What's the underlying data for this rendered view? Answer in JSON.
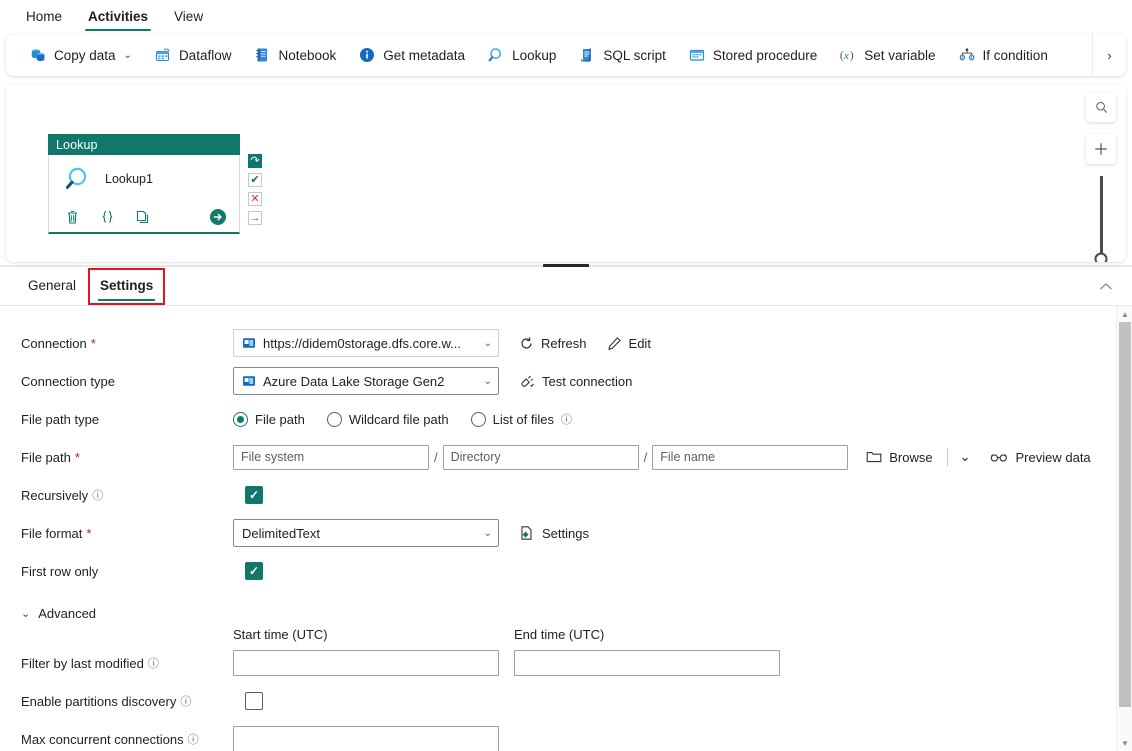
{
  "ribbon": {
    "tabs": [
      {
        "label": "Home",
        "active": false
      },
      {
        "label": "Activities",
        "active": true
      },
      {
        "label": "View",
        "active": false
      }
    ]
  },
  "command_bar": {
    "items": [
      {
        "label": "Copy data",
        "icon": "copy-data-icon",
        "has_chevron": true
      },
      {
        "label": "Dataflow",
        "icon": "dataflow-icon",
        "has_chevron": false
      },
      {
        "label": "Notebook",
        "icon": "notebook-icon",
        "has_chevron": false
      },
      {
        "label": "Get metadata",
        "icon": "info-circle-icon",
        "has_chevron": false
      },
      {
        "label": "Lookup",
        "icon": "magnifier-icon",
        "has_chevron": false
      },
      {
        "label": "SQL script",
        "icon": "sql-script-icon",
        "has_chevron": false
      },
      {
        "label": "Stored procedure",
        "icon": "stored-procedure-icon",
        "has_chevron": false
      },
      {
        "label": "Set variable",
        "icon": "set-variable-icon",
        "has_chevron": false
      },
      {
        "label": "If condition",
        "icon": "if-condition-icon",
        "has_chevron": false
      }
    ],
    "overflow_label": "›"
  },
  "canvas": {
    "node": {
      "header": "Lookup",
      "title": "Lookup1",
      "icon": "magnifier-icon",
      "actions": [
        {
          "name": "delete-activity-button",
          "glyph": "delete-icon"
        },
        {
          "name": "code-view-button",
          "glyph": "braces-icon"
        },
        {
          "name": "clone-activity-button",
          "glyph": "copy-icon"
        },
        {
          "name": "run-activity-button",
          "glyph": "arrow-right-circle-icon"
        }
      ],
      "badges": [
        {
          "name": "on-skip-badge",
          "glyph": "↷",
          "style": "teal"
        },
        {
          "name": "on-success-badge",
          "glyph": "✔",
          "style": "green"
        },
        {
          "name": "on-failure-badge",
          "glyph": "✕",
          "style": "red"
        },
        {
          "name": "on-completion-badge",
          "glyph": "→",
          "style": "blue"
        }
      ]
    },
    "zoom_controls": {
      "fit_label": "zoom-to-fit",
      "add_label": "+",
      "slider_value": 72
    }
  },
  "properties": {
    "tabs": [
      {
        "label": "General",
        "active": false,
        "annotated": false
      },
      {
        "label": "Settings",
        "active": true,
        "annotated": true
      }
    ],
    "collapse_label": "⌃",
    "fields": {
      "connection": {
        "label": "Connection",
        "required": true,
        "value": "https://didem0storage.dfs.core.w...",
        "icon": "connection-icon",
        "refresh_label": "Refresh",
        "edit_label": "Edit"
      },
      "connection_type": {
        "label": "Connection type",
        "required": false,
        "value": "Azure Data Lake Storage Gen2",
        "icon": "connection-icon",
        "test_label": "Test connection"
      },
      "file_path_type": {
        "label": "File path type",
        "options": [
          {
            "label": "File path",
            "selected": true,
            "info": false
          },
          {
            "label": "Wildcard file path",
            "selected": false,
            "info": false
          },
          {
            "label": "List of files",
            "selected": false,
            "info": true
          }
        ]
      },
      "file_path": {
        "label": "File path",
        "required": true,
        "file_system_placeholder": "File system",
        "file_system_value": "",
        "directory_placeholder": "Directory",
        "directory_value": "",
        "file_name_placeholder": "File name",
        "file_name_value": "",
        "separator": "/",
        "browse_label": "Browse",
        "browse_chevron": "⌄",
        "preview_label": "Preview data"
      },
      "recursively": {
        "label": "Recursively",
        "info": true,
        "checked": true
      },
      "file_format": {
        "label": "File format",
        "required": true,
        "value": "DelimitedText",
        "settings_label": "Settings"
      },
      "first_row_only": {
        "label": "First row only",
        "checked": true
      },
      "advanced": {
        "label": "Advanced",
        "expanded": true
      },
      "filter_by_last_modified": {
        "label": "Filter by last modified",
        "info": true,
        "start_header": "Start time (UTC)",
        "start_value": "",
        "end_header": "End time (UTC)",
        "end_value": ""
      },
      "enable_partitions_discovery": {
        "label": "Enable partitions discovery",
        "info": true,
        "checked": false
      },
      "max_concurrent_connections": {
        "label": "Max concurrent connections",
        "info": true,
        "value": ""
      }
    }
  },
  "colors": {
    "accent_teal": "#10776a",
    "required_red": "#a4262c",
    "annotation_red": "#e81123",
    "icon_blue": "#0f6cbd"
  }
}
